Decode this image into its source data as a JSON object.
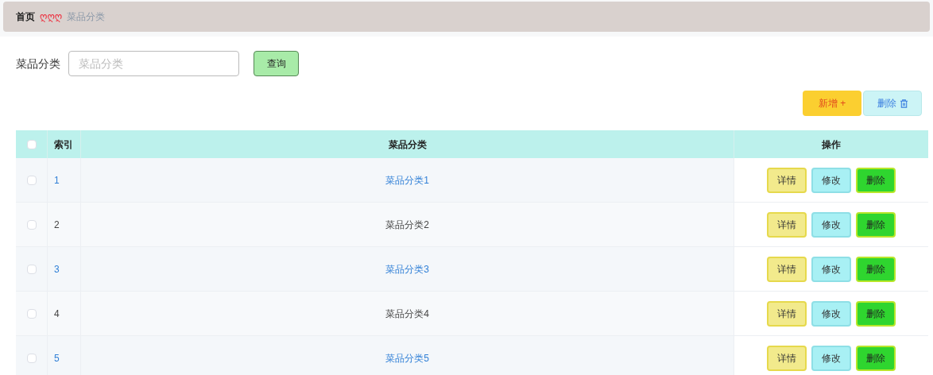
{
  "breadcrumb": {
    "home": "首页",
    "separator": "ღღღ",
    "current": "菜品分类"
  },
  "search": {
    "label": "菜品分类",
    "placeholder": "菜品分类",
    "button": "查询"
  },
  "toolbar": {
    "add": "新增 +",
    "delete": "删除"
  },
  "table": {
    "columns": [
      "索引",
      "菜品分类",
      "操作"
    ],
    "all_checked": false,
    "rows": [
      {
        "index": "1",
        "category": "菜品分类1",
        "kind": "link",
        "checked": false,
        "actions": [
          "详情",
          "修改",
          "删除"
        ]
      },
      {
        "index": "2",
        "category": "菜品分类2",
        "kind": "plain",
        "checked": false,
        "actions": [
          "详情",
          "修改",
          "删除"
        ]
      },
      {
        "index": "3",
        "category": "菜品分类3",
        "kind": "link",
        "checked": false,
        "actions": [
          "详情",
          "修改",
          "删除"
        ]
      },
      {
        "index": "4",
        "category": "菜品分类4",
        "kind": "plain",
        "checked": false,
        "actions": [
          "详情",
          "修改",
          "删除"
        ]
      },
      {
        "index": "5",
        "category": "菜品分类5",
        "kind": "link",
        "checked": false,
        "actions": [
          "详情",
          "修改",
          "删除"
        ]
      }
    ]
  }
}
